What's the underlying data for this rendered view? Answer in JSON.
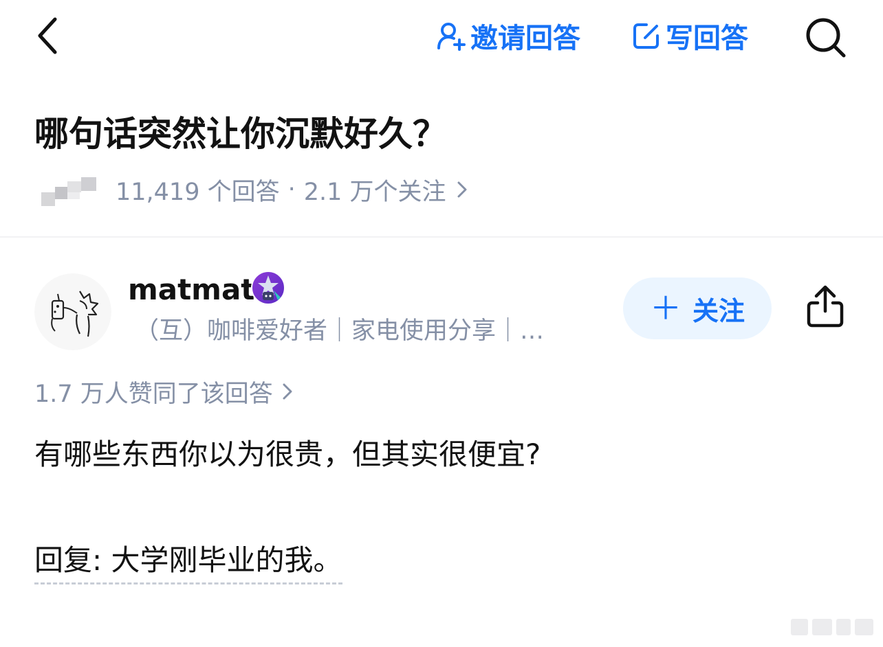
{
  "nav": {
    "invite_label": "邀请回答",
    "write_label": "写回答",
    "accent_color": "#1772f6"
  },
  "question": {
    "title": "哪句话突然让你沉默好久？",
    "answer_count": "11,419 个回答",
    "separator": "·",
    "follower_count": "2.1 万个关注"
  },
  "answer": {
    "author": {
      "name": "matmat",
      "bio": "（互）咖啡爱好者｜家电使用分享｜…",
      "follow_label": "关注",
      "follow_icon": "plus-icon"
    },
    "vote_info": "1.7 万人赞同了该回答",
    "paragraphs": [
      "有哪些东西你以为很贵，但其实很便宜?",
      "回复: 大学刚毕业的我。"
    ]
  },
  "icons": {
    "back": "chevron-left-icon",
    "invite": "person-add-icon",
    "write": "edit-icon",
    "search": "search-icon",
    "share": "share-icon",
    "badge": "star-badge-icon"
  }
}
